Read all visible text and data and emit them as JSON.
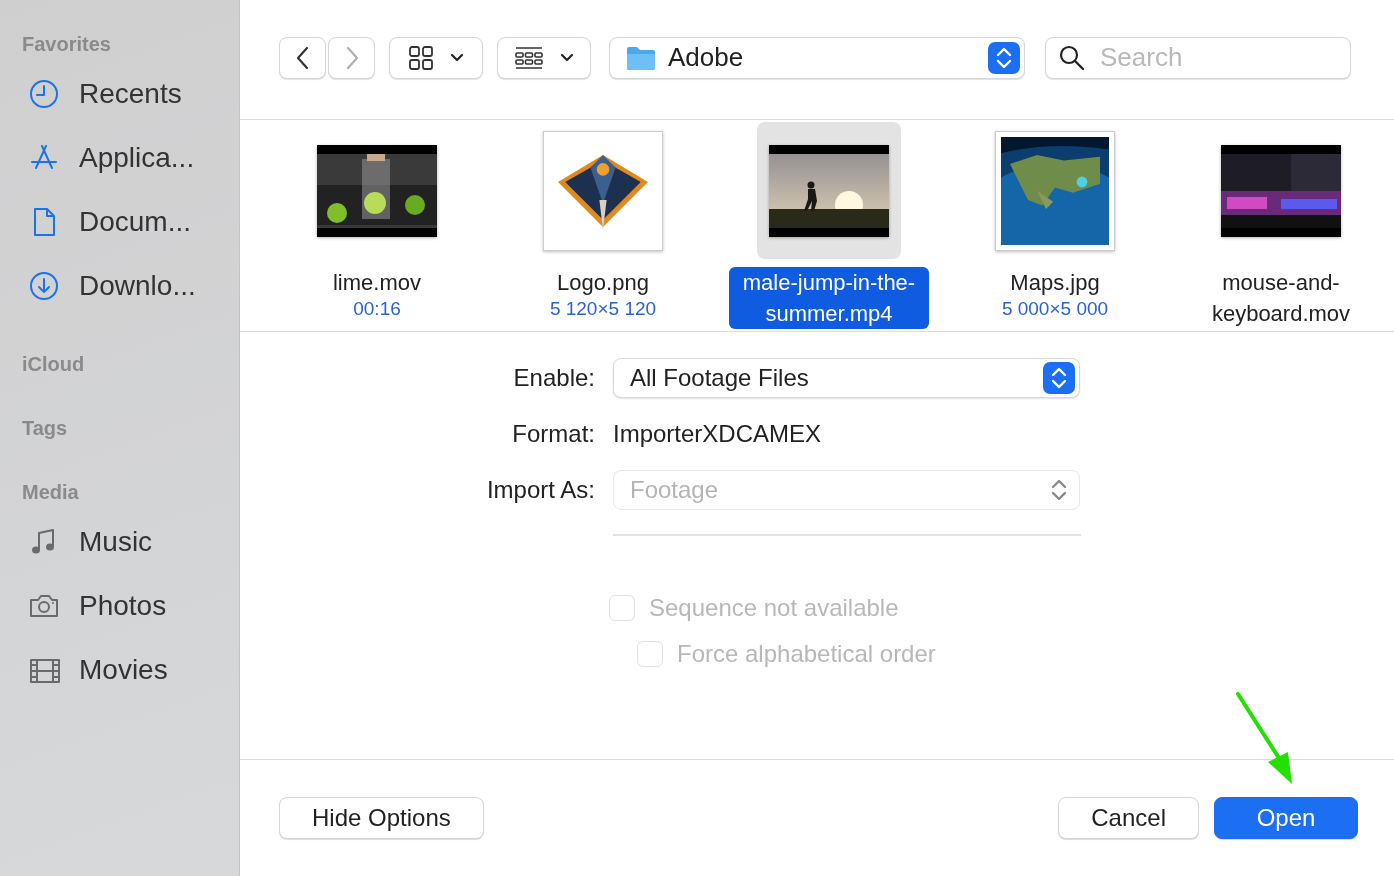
{
  "sidebar": {
    "sections": [
      {
        "title": "Favorites",
        "items": [
          {
            "label": "Recents",
            "kind": "recents"
          },
          {
            "label": "Applica...",
            "kind": "applications"
          },
          {
            "label": "Docum...",
            "kind": "documents"
          },
          {
            "label": "Downlo...",
            "kind": "downloads"
          }
        ]
      },
      {
        "title": "iCloud"
      },
      {
        "title": "Tags"
      },
      {
        "title": "Media",
        "items": [
          {
            "label": "Music",
            "kind": "music"
          },
          {
            "label": "Photos",
            "kind": "photos"
          },
          {
            "label": "Movies",
            "kind": "movies"
          }
        ]
      }
    ]
  },
  "toolbar": {
    "back": {
      "disabled": false
    },
    "forward": {
      "disabled": true
    },
    "location": {
      "label": "Adobe"
    },
    "search": {
      "placeholder": "Search"
    }
  },
  "files": [
    {
      "name": "lime.mov",
      "detail": "00:16",
      "kind": "video",
      "selected": false
    },
    {
      "name": "Logo.png",
      "detail": "5 120×5 120",
      "selected": false
    },
    {
      "name": "male-jump-in-the-summer.mp4",
      "kind": "video",
      "selected": true
    },
    {
      "name": "Maps.jpg",
      "detail": "5 000×5 000",
      "selected": false
    },
    {
      "name": "mouse-and-keyboard.mov",
      "kind": "video",
      "selected": false
    }
  ],
  "options": {
    "rows": [
      {
        "kind": "select",
        "label": "Enable:",
        "value": "All Footage Files",
        "disabled": false
      },
      {
        "kind": "text",
        "label": "Format:",
        "value": "ImporterXDCAMEX"
      },
      {
        "kind": "select",
        "label": "Import As:",
        "value": "Footage",
        "disabled": true
      }
    ],
    "checkboxes": [
      {
        "label": "Sequence not available",
        "checked": false,
        "disabled": true,
        "children": [
          {
            "label": "Force alphabetical order",
            "checked": false,
            "disabled": true
          }
        ]
      }
    ]
  },
  "bottom_bar": {
    "left_buttons": [
      {
        "label": "Hide Options",
        "default": false
      }
    ],
    "right_buttons": [
      {
        "label": "Cancel",
        "default": false
      },
      {
        "label": "Open",
        "default": true
      }
    ]
  },
  "annotations": [
    {
      "kind": "arrow"
    }
  ]
}
